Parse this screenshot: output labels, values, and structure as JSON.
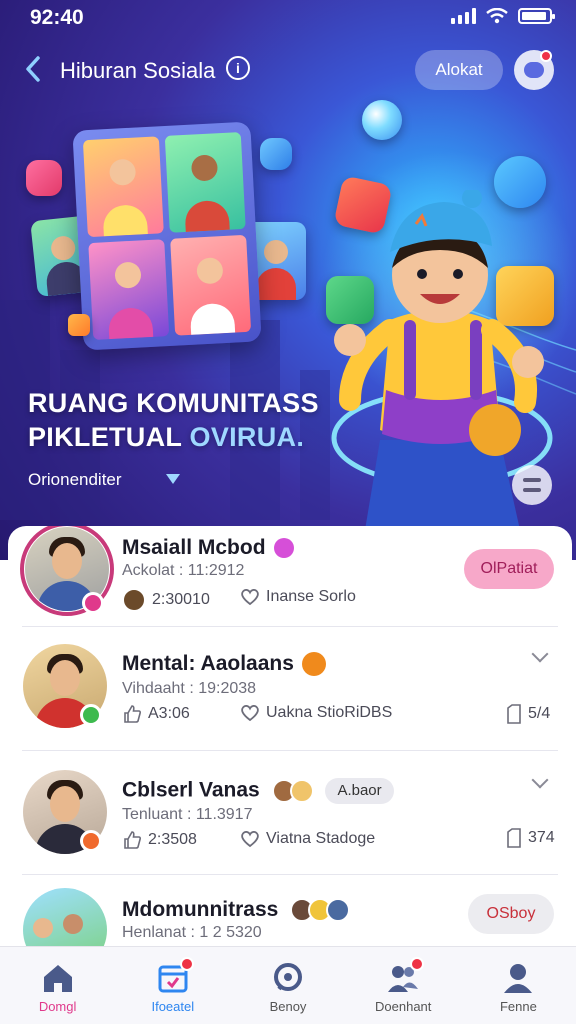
{
  "status_bar": {
    "time": "92:40"
  },
  "header": {
    "title": "Hiburan Sosiala",
    "follow_label": "Alokat"
  },
  "hero": {
    "heading_line1": "RUANG KOMUNITASS",
    "heading_line2_a": "PIKLETUAL ",
    "heading_line2_b": "OVIRUA.",
    "subtitle": "Orionenditer"
  },
  "list": [
    {
      "name": "Msaiall Mcbod",
      "meta": "Ackolat : 11:2912",
      "stat1": "2:30010",
      "stat2": "Inanse Sorlo",
      "action_label": "OlPatiat",
      "badge_color": "#e0398b",
      "verified_color": "#d64fd8"
    },
    {
      "name": "Mental: Aaolaans",
      "meta": "Vihdaaht : 19:2038",
      "stat1": "A3:06",
      "stat2": "Uakna StioRiDBS",
      "count": "5/4",
      "badge_color": "#3dba4e",
      "verified_color": "#f08a1c"
    },
    {
      "name": "Cblserl Vanas",
      "tag": "A.baor",
      "meta": "Tenluant : 11.3917",
      "stat1": "2:3508",
      "stat2": "Viatna Stadoge",
      "count": "374",
      "badge_color": "#f06a2e"
    },
    {
      "name": "Mdomunnitrass",
      "meta": "Henlanat : 1 2 5320",
      "action_label": "OSboy"
    }
  ],
  "bottom_nav": [
    {
      "label": "Domgl",
      "icon": "home-icon",
      "active": true
    },
    {
      "label": "Ifoeatel",
      "icon": "calendar-icon",
      "active": false
    },
    {
      "label": "Benoy",
      "icon": "chat-icon",
      "active": false
    },
    {
      "label": "Doenhant",
      "icon": "people-icon",
      "active": false
    },
    {
      "label": "Fenne",
      "icon": "profile-icon",
      "active": false
    }
  ],
  "colors": {
    "hero_bg": "#3b2f9e",
    "accent_pink": "#f7a8c9",
    "active_tab": "#e0398b"
  }
}
